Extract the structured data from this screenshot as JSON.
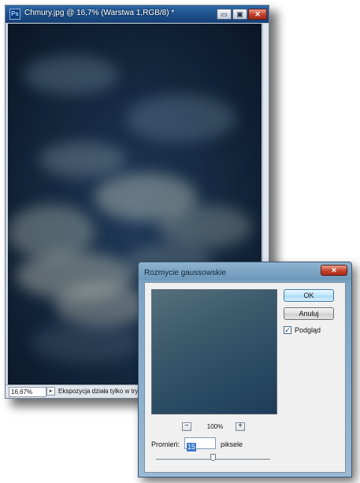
{
  "document_window": {
    "title": "Chmury.jpg @ 16,7% (Warstwa 1,RGB/8) *",
    "app_icon": "photoshop-icon",
    "controls": [
      "minimize-icon",
      "maximize-icon",
      "close-icon"
    ],
    "status": {
      "zoom": "16,67%",
      "message": "Ekspozycja działa tylko w trybi"
    }
  },
  "dialog": {
    "title": "Rozmycie gaussowskie",
    "ok_label": "OK",
    "cancel_label": "Anuluj",
    "preview_checkbox": {
      "label": "Podgląd",
      "checked": true,
      "mark": "✓"
    },
    "preview_zoom": "100%",
    "zoom_out_symbol": "−",
    "zoom_in_symbol": "+",
    "radius": {
      "label": "Promień:",
      "value": "15",
      "unit": "piksele"
    }
  },
  "colors": {
    "title_bar": "#1d4f8a",
    "canvas_dark": "#0a1626",
    "dialog_frame": "#6d98bb",
    "ok_button": "#bee6fd"
  }
}
